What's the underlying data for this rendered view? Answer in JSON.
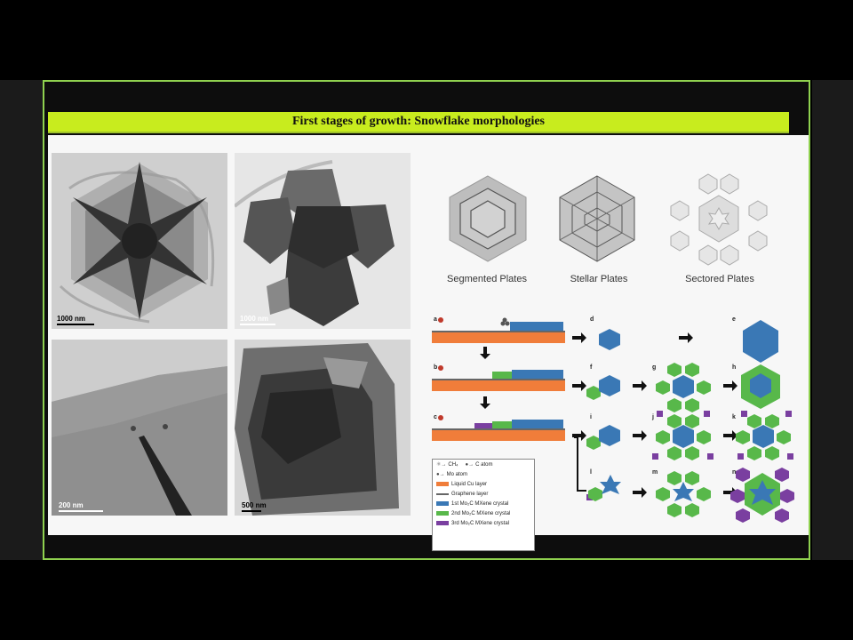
{
  "slide": {
    "title": "First stages of growth: Snowflake morphologies"
  },
  "micrographs": [
    {
      "scale": "1000 nm"
    },
    {
      "scale": "1000 nm"
    },
    {
      "scale": "200 nm"
    },
    {
      "scale": "500 nm"
    }
  ],
  "morphologies": [
    {
      "label": "Segmented Plates"
    },
    {
      "label": "Stellar Plates"
    },
    {
      "label": "Sectored Plates"
    }
  ],
  "scheme": {
    "rows": [
      "a",
      "b",
      "c"
    ],
    "panels": [
      "d",
      "e",
      "f",
      "g",
      "h",
      "i",
      "j",
      "k",
      "l",
      "m",
      "n"
    ]
  },
  "legend": {
    "ch4": "CH₄",
    "c_atom": "C atom",
    "mo_atom": "Mo atom",
    "liquid_cu": "Liquid Cu layer",
    "graphene": "Graphene layer",
    "mxene1": "1st Mo₂C MXene crystal",
    "mxene2": "2nd Mo₂C MXene crystal",
    "mxene3": "3rd Mo₂C MXene crystal"
  },
  "colors": {
    "accent_bar": "#c8ec1e",
    "frame": "#8fd14f",
    "cu": "#f07d3a",
    "mxene1": "#3a78b5",
    "mxene2": "#58b84a",
    "mxene3": "#7a3fa0"
  }
}
